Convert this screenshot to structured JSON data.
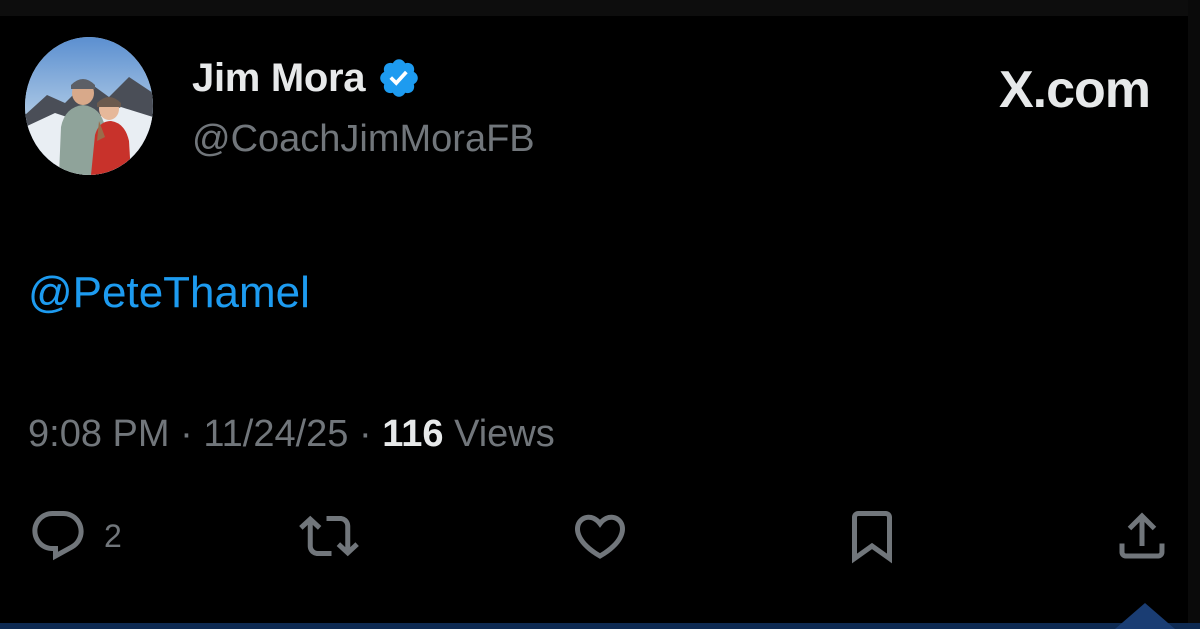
{
  "author": {
    "display_name": "Jim Mora",
    "handle": "@CoachJimMoraFB",
    "verified_icon": "verified-badge-icon",
    "verified_color": "#1d9bf0"
  },
  "brand": {
    "label": "X.com"
  },
  "tweet": {
    "text": "@PeteThamel",
    "time": "9:08 PM",
    "date": "11/24/25",
    "separator": "·",
    "views_count": "116",
    "views_label": "Views"
  },
  "actions": {
    "reply_count": "2",
    "icons": [
      "reply-icon",
      "retweet-icon",
      "like-icon",
      "bookmark-icon",
      "share-icon"
    ]
  },
  "colors": {
    "background": "#000000",
    "text_primary": "#e7e9ea",
    "text_secondary": "#71767b",
    "link": "#1d9bf0"
  }
}
